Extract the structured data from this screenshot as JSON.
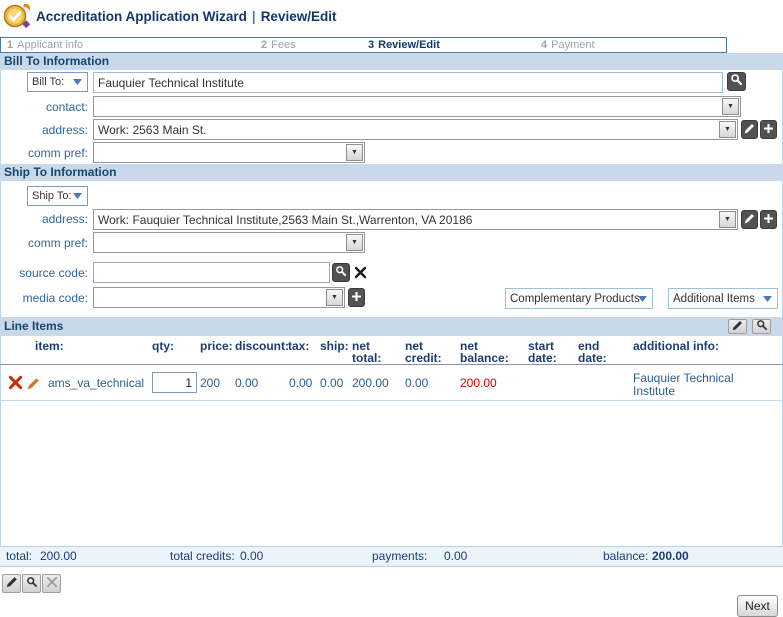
{
  "header": {
    "title": "Accreditation Application Wizard",
    "separator": "|",
    "subtitle": "Review/Edit"
  },
  "steps": [
    {
      "number": "1",
      "label": "Applicant info",
      "active": false
    },
    {
      "number": "2",
      "label": "Fees",
      "active": false
    },
    {
      "number": "3",
      "label": "Review/Edit",
      "active": true
    },
    {
      "number": "4",
      "label": "Payment",
      "active": false
    }
  ],
  "bill_to": {
    "section_title": "Bill To Information",
    "selector_label": "Bill To:",
    "name_value": "Fauquier Technical Institute",
    "contact_label": "contact:",
    "contact_value": "",
    "address_label": "address:",
    "address_value": "Work: 2563 Main St.",
    "comm_pref_label": "comm pref:",
    "comm_pref_value": ""
  },
  "ship_to": {
    "section_title": "Ship To Information",
    "selector_label": "Ship To:",
    "address_label": "address:",
    "address_value": "Work: Fauquier Technical Institute,2563 Main St.,Warrenton, VA 20186",
    "comm_pref_label": "comm pref:",
    "comm_pref_value": ""
  },
  "codes": {
    "source_code_label": "source code:",
    "source_code_value": "",
    "media_code_label": "media code:",
    "media_code_value": ""
  },
  "product_dropdowns": {
    "complementary": "Complementary Products",
    "additional": "Additional Items"
  },
  "line_items": {
    "section_title": "Line Items",
    "columns": [
      "item:",
      "qty:",
      "price:",
      "discount:",
      "tax:",
      "ship:",
      "net total:",
      "net credit:",
      "net balance:",
      "start date:",
      "end date:",
      "additional info:"
    ],
    "rows": [
      {
        "item": "ams_va_technical",
        "qty": "1",
        "price": "200",
        "discount": "0.00",
        "tax": "0.00",
        "ship": "0.00",
        "net_total": "200.00",
        "net_credit": "0.00",
        "net_balance": "200.00",
        "start_date": "",
        "end_date": "",
        "additional_info": "Fauquier Technical Institute"
      }
    ]
  },
  "totals": {
    "total_label": "total:",
    "total_value": "200.00",
    "credits_label": "total credits:",
    "credits_value": "0.00",
    "payments_label": "payments:",
    "payments_value": "0.00",
    "balance_label": "balance:",
    "balance_value": "200.00"
  },
  "footer": {
    "next_label": "Next"
  },
  "icons": {
    "wizard_logo": "gold-circle-check",
    "search": "magnifier",
    "edit": "pencil",
    "add": "plus",
    "clear": "x",
    "delete_row": "x",
    "dropdown": "chevron-down"
  },
  "colors": {
    "accent_navy": "#14466e",
    "label_blue": "#336699",
    "section_bg": "#c9d9ea",
    "step_border": "#4d7aa8",
    "negative_red": "#d50000",
    "delete_red": "#cc2b00",
    "pencil_orange": "#c87b2e"
  }
}
